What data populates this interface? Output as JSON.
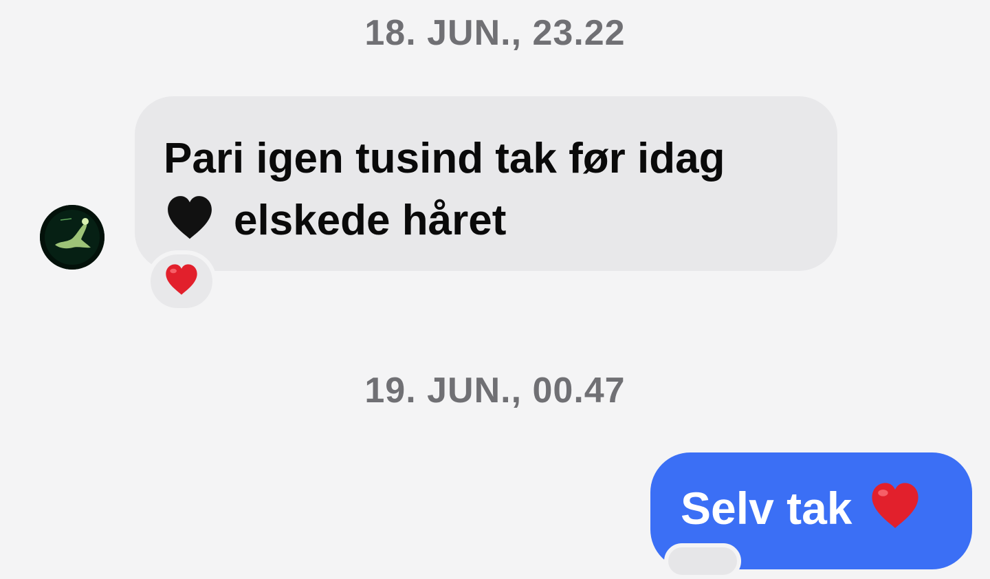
{
  "conversation": {
    "timestamps": [
      "18. JUN., 23.22",
      "19. JUN., 00.47"
    ],
    "incoming": {
      "line1": "Pari igen tusind tak før idag",
      "line2": "elskede håret",
      "line2_emoji": "black-heart-icon",
      "reaction_emoji": "red-heart-icon"
    },
    "outgoing": {
      "text": "Selv tak",
      "emoji": "red-heart-icon"
    }
  },
  "colors": {
    "background": "#f4f4f5",
    "incoming_bubble": "#e8e8ea",
    "outgoing_bubble": "#3b6ff5",
    "timestamp": "#707074",
    "red_heart": "#e2202c",
    "black_heart": "#111111"
  }
}
